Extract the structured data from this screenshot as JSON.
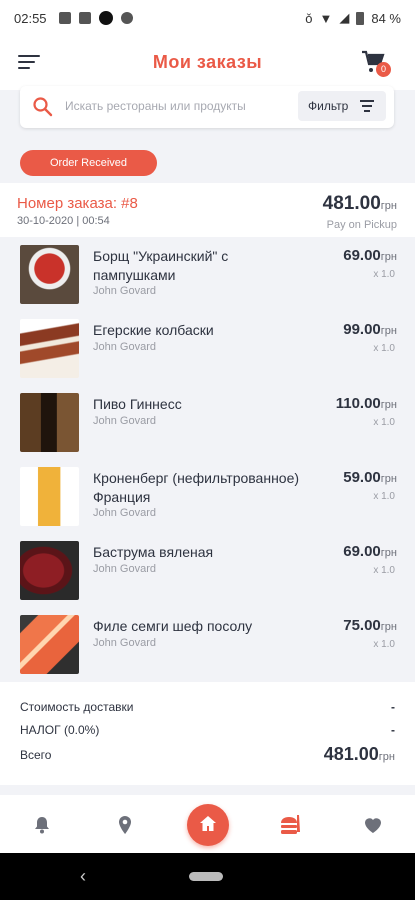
{
  "status_bar": {
    "time": "02:55",
    "battery": "84 %"
  },
  "header": {
    "title": "Мои заказы",
    "cart_badge": "0"
  },
  "search": {
    "placeholder": "Искать рестораны или продукты",
    "filter_label": "Фильтр"
  },
  "order": {
    "status": "Order Received",
    "number": "Номер заказа: #8",
    "date": "30-10-2020 | 00:54",
    "total": "481.00",
    "currency": "грн",
    "payment": "Pay on Pickup",
    "items": [
      {
        "name": "Борщ \"Украинский\" с пампушками",
        "vendor": "John Govard",
        "price": "69.00",
        "currency": "грн",
        "qty": "x 1.0",
        "image": "borscht"
      },
      {
        "name": "Егерские колбаски",
        "vendor": "John Govard",
        "price": "99.00",
        "currency": "грн",
        "qty": "x 1.0",
        "image": "sausages"
      },
      {
        "name": "Пиво Гиннесс",
        "vendor": "John Govard",
        "price": "110.00",
        "currency": "грн",
        "qty": "x 1.0",
        "image": "beer-dark"
      },
      {
        "name": "Кроненберг (нефильтрованное) Франция",
        "vendor": "John Govard",
        "price": "59.00",
        "currency": "грн",
        "qty": "x 1.0",
        "image": "beer-light"
      },
      {
        "name": "Баструма вяленая",
        "vendor": "John Govard",
        "price": "69.00",
        "currency": "грн",
        "qty": "x 1.0",
        "image": "basturma"
      },
      {
        "name": "Филе семги шеф посолу",
        "vendor": "John Govard",
        "price": "75.00",
        "currency": "грн",
        "qty": "x 1.0",
        "image": "salmon"
      }
    ],
    "summary": {
      "delivery_label": "Стоимость доставки",
      "delivery_value": "-",
      "tax_label": "НАЛОГ (0.0%)",
      "tax_value": "-",
      "total_label": "Всего",
      "total_value": "481.00",
      "total_currency": "грн"
    }
  },
  "tabbar": {
    "tabs": [
      "notifications-icon",
      "location-icon",
      "home-icon",
      "orders-icon",
      "favorites-icon"
    ],
    "active": "orders-icon"
  },
  "colors": {
    "accent": "#ea5a47",
    "text": "#2e3340",
    "background": "#f2f3f7"
  }
}
